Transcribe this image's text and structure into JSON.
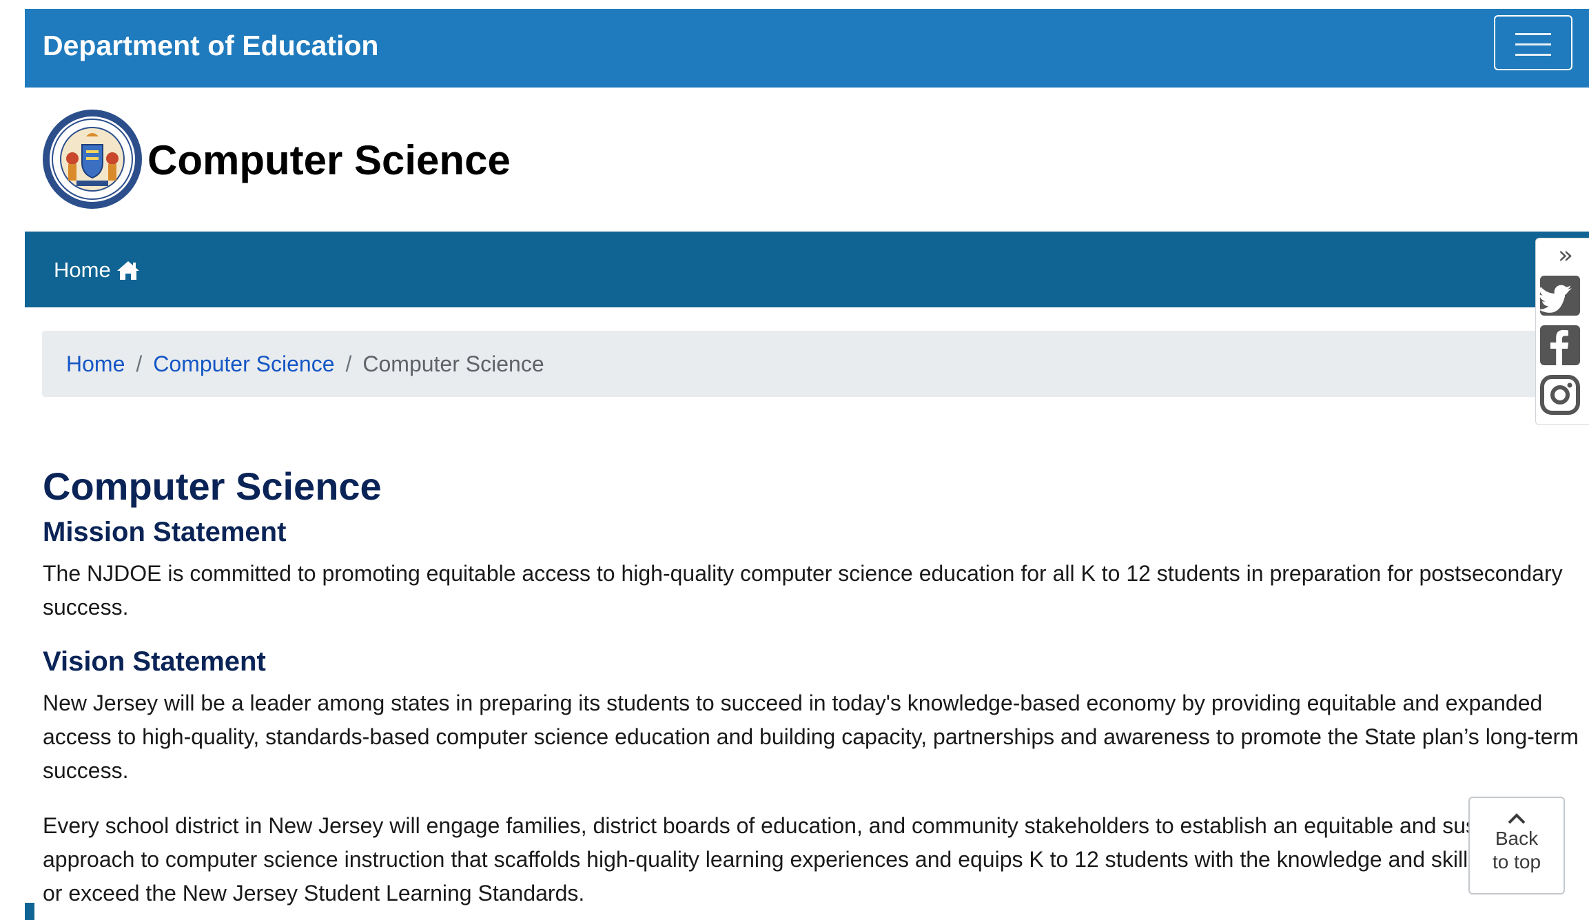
{
  "header": {
    "site_title": "Department of Education"
  },
  "hero": {
    "title": "Computer Science",
    "seal_icon": "nj-department-of-education-seal"
  },
  "nav": {
    "home_label": "Home",
    "home_icon": "home-icon"
  },
  "breadcrumb": {
    "items": [
      "Home",
      "Computer Science"
    ],
    "current": "Computer Science",
    "separator": "/"
  },
  "content": {
    "title": "Computer Science",
    "mission_heading": "Mission Statement",
    "mission_text": "The NJDOE is committed to promoting equitable access to high-quality computer science education for all K to 12 students in preparation for postsecondary success.",
    "vision_heading": "Vision Statement",
    "vision_text": "New Jersey will be a leader among states in preparing its students to succeed in today's knowledge-based economy by providing equitable and expanded access to high-quality, standards-based computer science education and building capacity, partnerships and awareness to promote the State plan’s long-term success.",
    "every_text": "Every school district in New Jersey will engage families, district boards of education, and community stakeholders to establish an equitable and sustainable approach to computer science instruction that scaffolds high-quality learning experiences and equips K to 12 students with the knowledge and skills to meet or exceed the New Jersey Student Learning Standards."
  },
  "social": {
    "collapse_glyph": "»",
    "icons": [
      "twitter-icon",
      "facebook-icon",
      "instagram-icon"
    ]
  },
  "back_to_top": {
    "label": "Back to top"
  },
  "colors": {
    "header_blue": "#1f7bbd",
    "nav_blue": "#0f6493",
    "heading_navy": "#0b2457",
    "link_blue": "#1456c4",
    "breadcrumb_bg": "#e9ecef"
  }
}
